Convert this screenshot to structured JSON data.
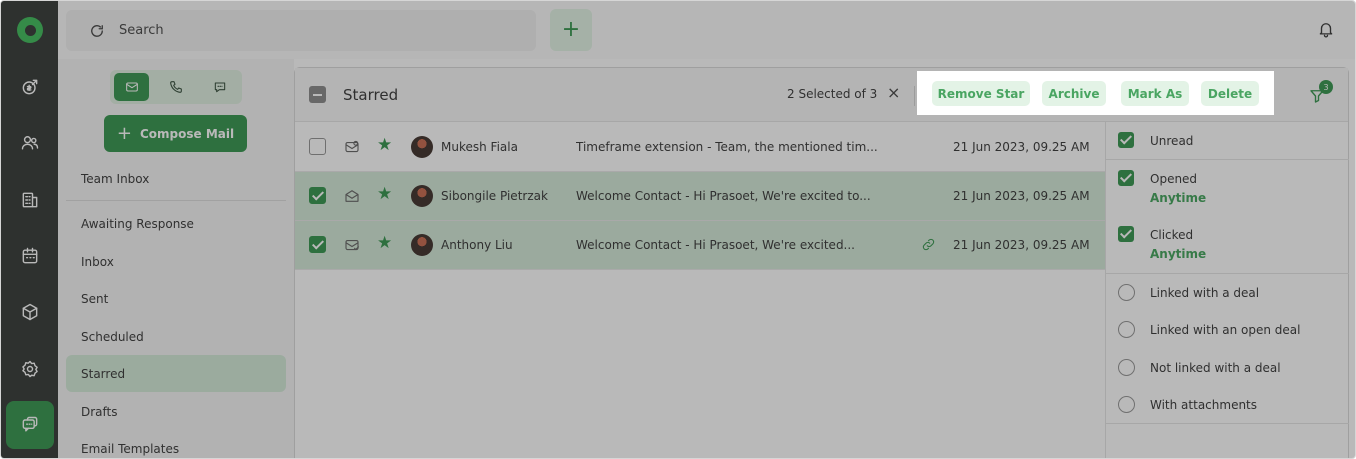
{
  "topbar": {
    "search_placeholder": "Search",
    "add_label": "+"
  },
  "rail": {
    "items": [
      "deals-icon",
      "contacts-icon",
      "company-icon",
      "calendar-icon",
      "products-icon",
      "settings-icon",
      "chat-icon"
    ]
  },
  "sidebar": {
    "compose_label": "Compose Mail",
    "compose_plus": "+",
    "team_inbox": "Team Inbox",
    "items": [
      {
        "label": "Awaiting Response",
        "active": false
      },
      {
        "label": "Inbox",
        "active": false
      },
      {
        "label": "Sent",
        "active": false
      },
      {
        "label": "Scheduled",
        "active": false
      },
      {
        "label": "Starred",
        "active": true
      },
      {
        "label": "Drafts",
        "active": false
      },
      {
        "label": "Email Templates",
        "active": false
      }
    ]
  },
  "header": {
    "title": "Starred",
    "selection_text": "2 Selected of 3",
    "close_glyph": "×",
    "actions": [
      "Remove Star",
      "Archive",
      "Mark As",
      "Delete"
    ],
    "filter_count": "3"
  },
  "emails": [
    {
      "checked": false,
      "name": "Mukesh Fiala",
      "subject": "Timeframe extension  -  Team, the mentioned tim...",
      "date": "21 Jun 2023, 09.25 AM",
      "linked": false
    },
    {
      "checked": true,
      "name": "Sibongile Pietrzak",
      "subject": "Welcome Contact  -  Hi Prasoet, We're excited to...",
      "date": "21 Jun 2023, 09.25 AM",
      "linked": false
    },
    {
      "checked": true,
      "name": "Anthony Liu",
      "subject": "Welcome Contact  -  Hi Prasoet, We're excited...",
      "date": "21 Jun 2023, 09.25 AM",
      "linked": true
    }
  ],
  "filters": {
    "unread": "Unread",
    "opened": "Opened",
    "opened_when": "Anytime",
    "clicked": "Clicked",
    "clicked_when": "Anytime",
    "linked_deal": "Linked with a deal",
    "linked_open_deal": "Linked with an open deal",
    "not_linked": "Not linked with a deal",
    "attachments": "With attachments"
  },
  "colors": {
    "brand_green": "#1f8a3a",
    "selected_row": "#cfe7d3",
    "action_bg": "#e3f3e6",
    "rail_bg": "#1f2421"
  }
}
